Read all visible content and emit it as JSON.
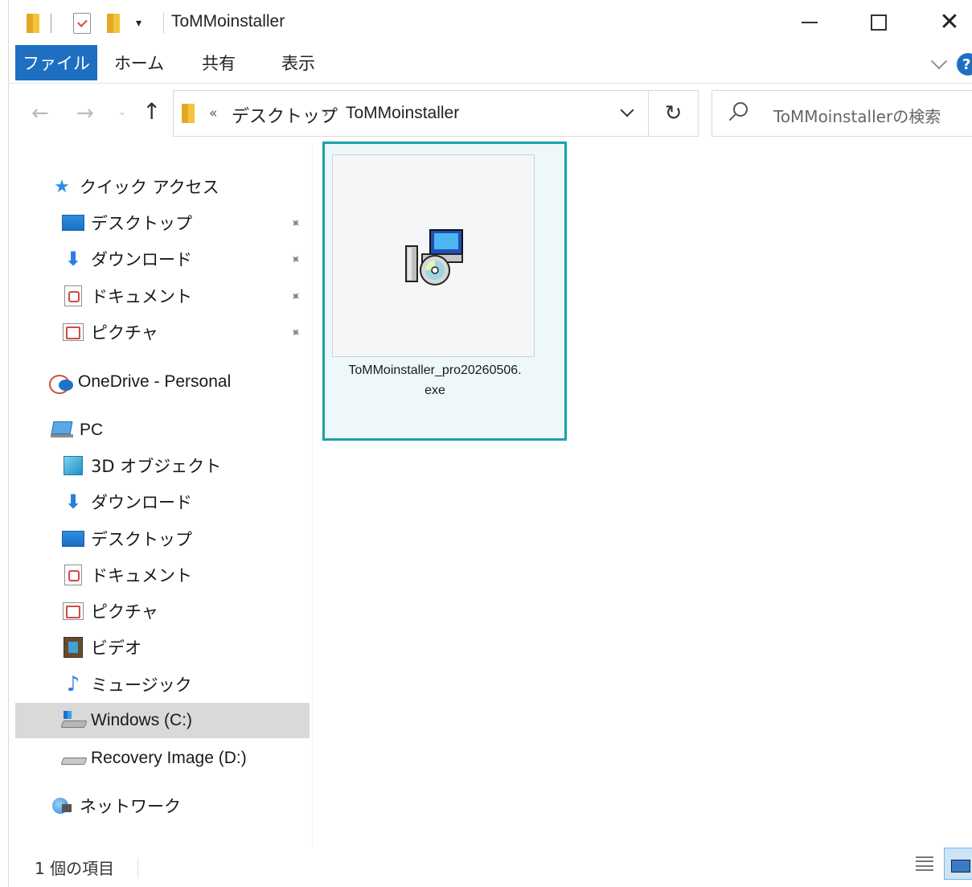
{
  "window": {
    "title": "ToMMoinstaller",
    "qa_dropdown_glyph": "▾",
    "controls": {
      "minimize": "",
      "maximize": "",
      "close": "✕"
    }
  },
  "ribbon": {
    "tabs": [
      {
        "label": "ファイル",
        "active": true
      },
      {
        "label": "ホーム",
        "active": false
      },
      {
        "label": "共有",
        "active": false
      },
      {
        "label": "表示",
        "active": false
      }
    ],
    "help": "?"
  },
  "navigation": {
    "back": "←",
    "forward": "→",
    "recent": "⌄",
    "up": "↑",
    "address": {
      "overflow": "«",
      "crumbs": [
        "デスクトップ",
        "ToMMoinstaller"
      ],
      "separator": "›"
    },
    "refresh": "↻",
    "search_placeholder": "ToMMoinstallerの検索"
  },
  "sidebar": {
    "quick_access": {
      "label": "クイック アクセス",
      "items": [
        {
          "label": "デスクトップ",
          "icon": "desktop-icon",
          "pinned": true
        },
        {
          "label": "ダウンロード",
          "icon": "download-icon",
          "pinned": true
        },
        {
          "label": "ドキュメント",
          "icon": "documents-icon",
          "pinned": true
        },
        {
          "label": "ピクチャ",
          "icon": "pictures-icon",
          "pinned": true
        }
      ]
    },
    "onedrive": {
      "label": "OneDrive - Personal",
      "icon": "onedrive-icon"
    },
    "pc": {
      "label": "PC",
      "items": [
        {
          "label": "3D オブジェクト",
          "icon": "3d-objects-icon"
        },
        {
          "label": "ダウンロード",
          "icon": "download-icon"
        },
        {
          "label": "デスクトップ",
          "icon": "desktop-icon"
        },
        {
          "label": "ドキュメント",
          "icon": "documents-icon"
        },
        {
          "label": "ピクチャ",
          "icon": "pictures-icon"
        },
        {
          "label": "ビデオ",
          "icon": "videos-icon"
        },
        {
          "label": "ミュージック",
          "icon": "music-icon"
        },
        {
          "label": "Windows (C:)",
          "icon": "drive-c-icon",
          "selected": true
        },
        {
          "label": "Recovery Image (D:)",
          "icon": "drive-d-icon"
        }
      ]
    },
    "network": {
      "label": "ネットワーク",
      "icon": "network-icon"
    },
    "pin_glyph": "📌"
  },
  "content": {
    "files": [
      {
        "name_line1": "ToMMoinstaller_pro20260506.",
        "name_line2": "exe",
        "icon": "installer-icon",
        "selected": true
      }
    ]
  },
  "status": {
    "item_count": "1 個の項目"
  },
  "colors": {
    "accent": "#1e6fc1",
    "highlight_border": "#1aa3a8",
    "selection_bg": "#d9d9d9"
  }
}
